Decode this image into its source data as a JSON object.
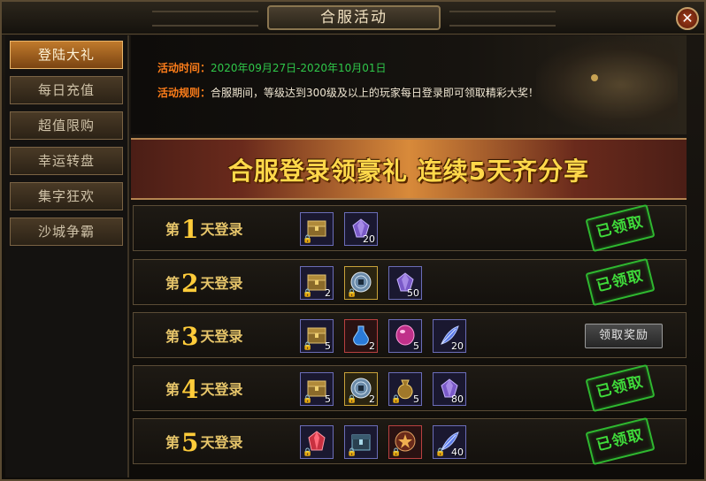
{
  "window": {
    "title": "合服活动",
    "close_label": "✕"
  },
  "sidebar": {
    "items": [
      {
        "label": "登陆大礼",
        "active": true
      },
      {
        "label": "每日充值",
        "active": false
      },
      {
        "label": "超值限购",
        "active": false
      },
      {
        "label": "幸运转盘",
        "active": false
      },
      {
        "label": "集字狂欢",
        "active": false
      },
      {
        "label": "沙城争霸",
        "active": false
      }
    ]
  },
  "info": {
    "time_label": "活动时间：",
    "time_value": "2020年09月27日-2020年10月01日",
    "rules_label": "活动规则：",
    "rules_value": "合服期间，等级达到300级及以上的玩家每日登录即可领取精彩大奖！"
  },
  "banner": {
    "text": "合服登录领豪礼 连续5天齐分享"
  },
  "rows": [
    {
      "prefix": "第",
      "num": "1",
      "suffix": "天登录",
      "status": "已领取",
      "items": [
        {
          "icon": "treasure-chest-icon",
          "count": "",
          "frame": "blue"
        },
        {
          "icon": "purple-gem-icon",
          "count": "20",
          "frame": "blue"
        }
      ]
    },
    {
      "prefix": "第",
      "num": "2",
      "suffix": "天登录",
      "status": "已领取",
      "items": [
        {
          "icon": "treasure-chest-icon",
          "count": "2",
          "frame": "blue"
        },
        {
          "icon": "jade-coin-icon",
          "count": "",
          "frame": "gold"
        },
        {
          "icon": "purple-gem-icon",
          "count": "50",
          "frame": "blue"
        }
      ]
    },
    {
      "prefix": "第",
      "num": "3",
      "suffix": "天登录",
      "button": "领取奖励",
      "items": [
        {
          "icon": "treasure-chest-icon",
          "count": "5",
          "frame": "blue"
        },
        {
          "icon": "blue-potion-icon",
          "count": "2",
          "frame": "red"
        },
        {
          "icon": "pink-orb-icon",
          "count": "5",
          "frame": "blue"
        },
        {
          "icon": "blue-feather-icon",
          "count": "20",
          "frame": "blue"
        }
      ]
    },
    {
      "prefix": "第",
      "num": "4",
      "suffix": "天登录",
      "status": "已领取",
      "items": [
        {
          "icon": "treasure-chest-icon",
          "count": "5",
          "frame": "blue"
        },
        {
          "icon": "jade-coin-icon",
          "count": "2",
          "frame": "gold"
        },
        {
          "icon": "gold-pouch-icon",
          "count": "5",
          "frame": "blue"
        },
        {
          "icon": "purple-gem-icon",
          "count": "80",
          "frame": "blue"
        }
      ]
    },
    {
      "prefix": "第",
      "num": "5",
      "suffix": "天登录",
      "status": "已领取",
      "items": [
        {
          "icon": "red-crystal-icon",
          "count": "",
          "frame": "blue"
        },
        {
          "icon": "dark-box-icon",
          "count": "",
          "frame": "blue"
        },
        {
          "icon": "star-medal-icon",
          "count": "",
          "frame": "red"
        },
        {
          "icon": "blue-feather-icon",
          "count": "40",
          "frame": "blue"
        }
      ]
    }
  ],
  "colors": {
    "accent_orange": "#ff7e1a",
    "date_green": "#2fc84a",
    "stamp_green": "#3fda3a",
    "banner_gold": "#ffd84a"
  }
}
